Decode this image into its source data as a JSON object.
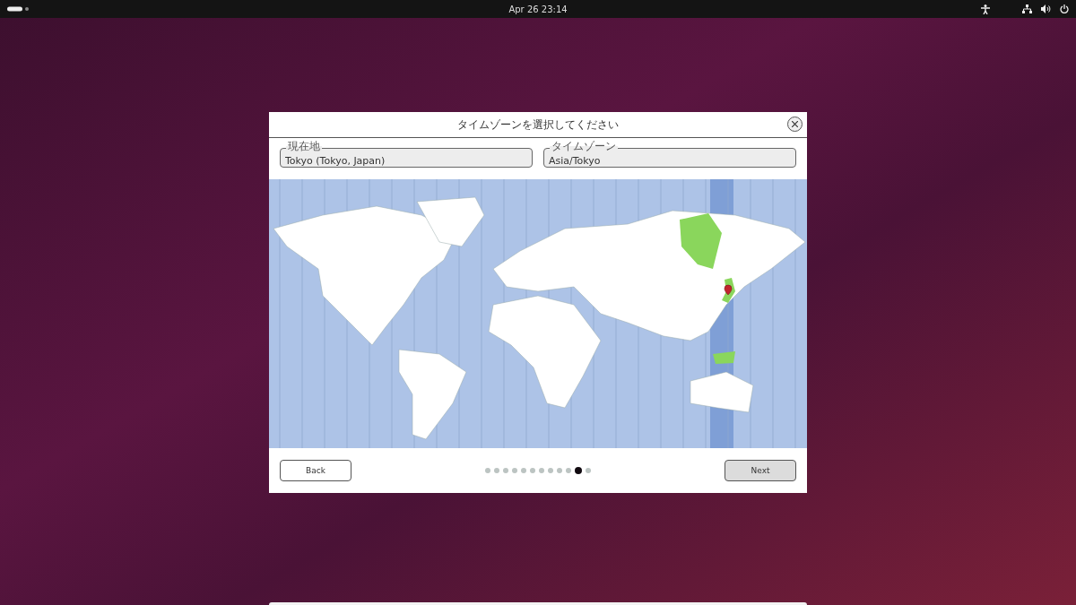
{
  "top_bar": {
    "clock": "Apr 26  23:14"
  },
  "dialog": {
    "title": "タイムゾーンを選択してください",
    "fields": [
      {
        "label": "現在地",
        "value": "Tokyo (Tokyo, Japan)"
      },
      {
        "label": "タイムゾーン",
        "value": "Asia/Tokyo"
      }
    ],
    "buttons": [
      {
        "label": "Back",
        "highlighted": false
      },
      {
        "label": "Next",
        "highlighted": true
      }
    ],
    "pages": [
      {
        "selected": false
      },
      {
        "selected": false
      },
      {
        "selected": false
      },
      {
        "selected": false
      },
      {
        "selected": false
      },
      {
        "selected": false
      },
      {
        "selected": false
      },
      {
        "selected": false
      },
      {
        "selected": false
      },
      {
        "selected": false
      },
      {
        "selected": true
      },
      {
        "selected": false
      }
    ]
  }
}
